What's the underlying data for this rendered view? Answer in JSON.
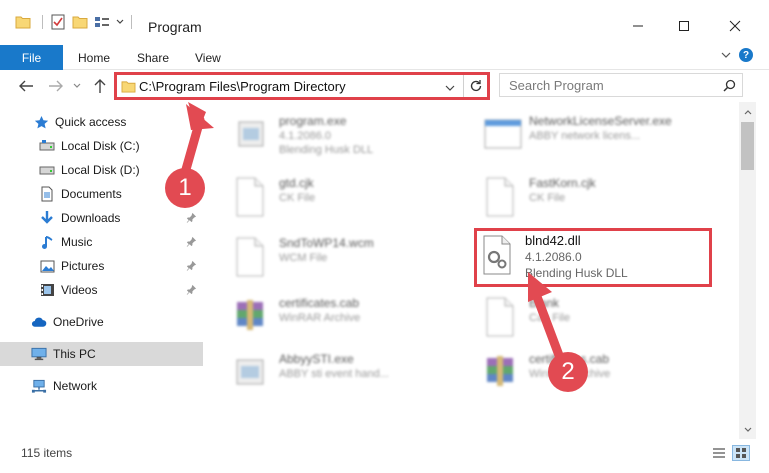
{
  "window": {
    "title": "Program"
  },
  "ribbon": {
    "file": "File",
    "home": "Home",
    "share": "Share",
    "view": "View"
  },
  "address": {
    "path": "C:\\Program Files\\Program Directory"
  },
  "search": {
    "placeholder": "Search Program"
  },
  "sidebar": {
    "items": [
      {
        "label": "Quick access",
        "icon": "star-icon"
      },
      {
        "label": "Local Disk (C:)",
        "icon": "drive-icon"
      },
      {
        "label": "Local Disk (D:)",
        "icon": "drive-icon"
      },
      {
        "label": "Documents",
        "icon": "documents-icon"
      },
      {
        "label": "Downloads",
        "icon": "download-icon"
      },
      {
        "label": "Music",
        "icon": "music-icon"
      },
      {
        "label": "Pictures",
        "icon": "pictures-icon"
      },
      {
        "label": "Videos",
        "icon": "videos-icon"
      },
      {
        "label": "OneDrive",
        "icon": "cloud-icon"
      },
      {
        "label": "This PC",
        "icon": "computer-icon"
      },
      {
        "label": "Network",
        "icon": "network-icon"
      }
    ]
  },
  "files": [
    {
      "name": "program.exe",
      "line1": "4.1.2086.0",
      "line2": "Blending Husk DLL"
    },
    {
      "name": "NetworkLicenseServer.exe",
      "line1": "ABBY network licens...",
      "line2": ""
    },
    {
      "name": "gtd.cjk",
      "line1": "CK File",
      "line2": ""
    },
    {
      "name": "FastKorn.cjk",
      "line1": "CK File",
      "line2": ""
    },
    {
      "name": "SndToWP14.wcm",
      "line1": "WCM File",
      "line2": ""
    },
    {
      "name": "certificates.cab",
      "line1": "WinRAR Archive",
      "line2": ""
    },
    {
      "name": "Blank",
      "line1": "Cab File",
      "line2": ""
    },
    {
      "name": "AbbyySTI.exe",
      "line1": "ABBY sti event hand...",
      "line2": ""
    },
    {
      "name": "certificates.cab",
      "line1": "WinRAR Archive",
      "line2": ""
    }
  ],
  "selected_file": {
    "name": "blnd42.dll",
    "line1": "4.1.2086.0",
    "line2": "Blending Husk DLL"
  },
  "callouts": {
    "one": "1",
    "two": "2"
  },
  "status": {
    "items": "115 items"
  },
  "colors": {
    "accent": "#1979ca",
    "callout": "#e24a52",
    "highlight_border": "#e0414a"
  }
}
